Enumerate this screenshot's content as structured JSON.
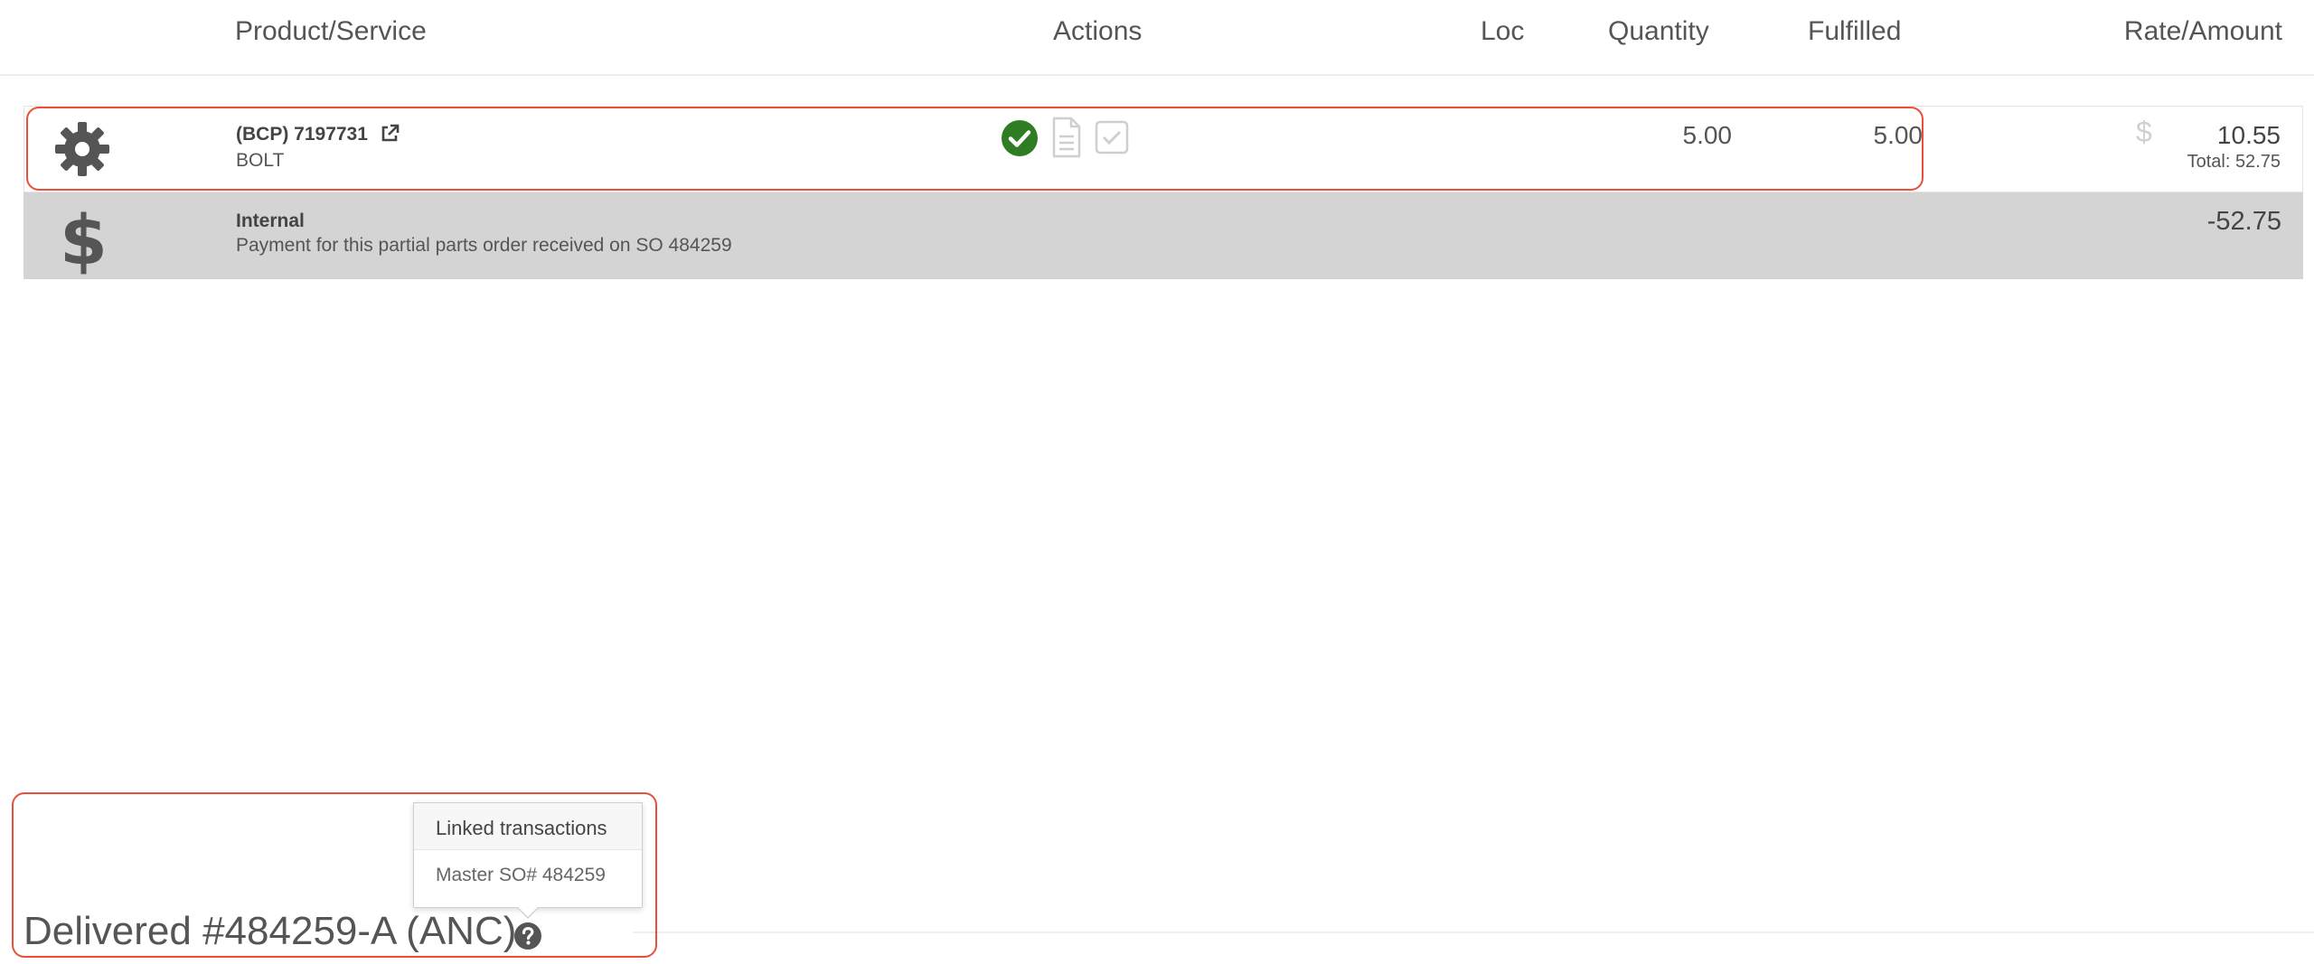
{
  "table": {
    "columns": {
      "product": "Product/Service",
      "actions": "Actions",
      "loc": "Loc",
      "quantity": "Quantity",
      "fulfilled": "Fulfilled",
      "rate_amount": "Rate/Amount"
    }
  },
  "line_item": {
    "icon": "gear-icon",
    "code": "(BCP)  7197731",
    "name": "BOLT",
    "actions": [
      "check-circle-icon",
      "document-icon",
      "checkbox-icon"
    ],
    "quantity": "5.00",
    "fulfilled": "5.00",
    "currency_symbol": "$",
    "rate": "10.55",
    "total": "Total: 52.75"
  },
  "payment": {
    "icon": "dollar-icon",
    "type": "Internal",
    "description": "Payment for this partial parts order received on SO 484259",
    "amount": "-52.75"
  },
  "delivered": {
    "title": "Delivered #484259-A (ANC)",
    "popover": {
      "title": "Linked transactions",
      "body": "Master SO# 484259"
    }
  },
  "colors": {
    "highlight": "#e8503a",
    "check_green": "#2e7d22",
    "payment_row_bg": "#d4d4d4"
  }
}
